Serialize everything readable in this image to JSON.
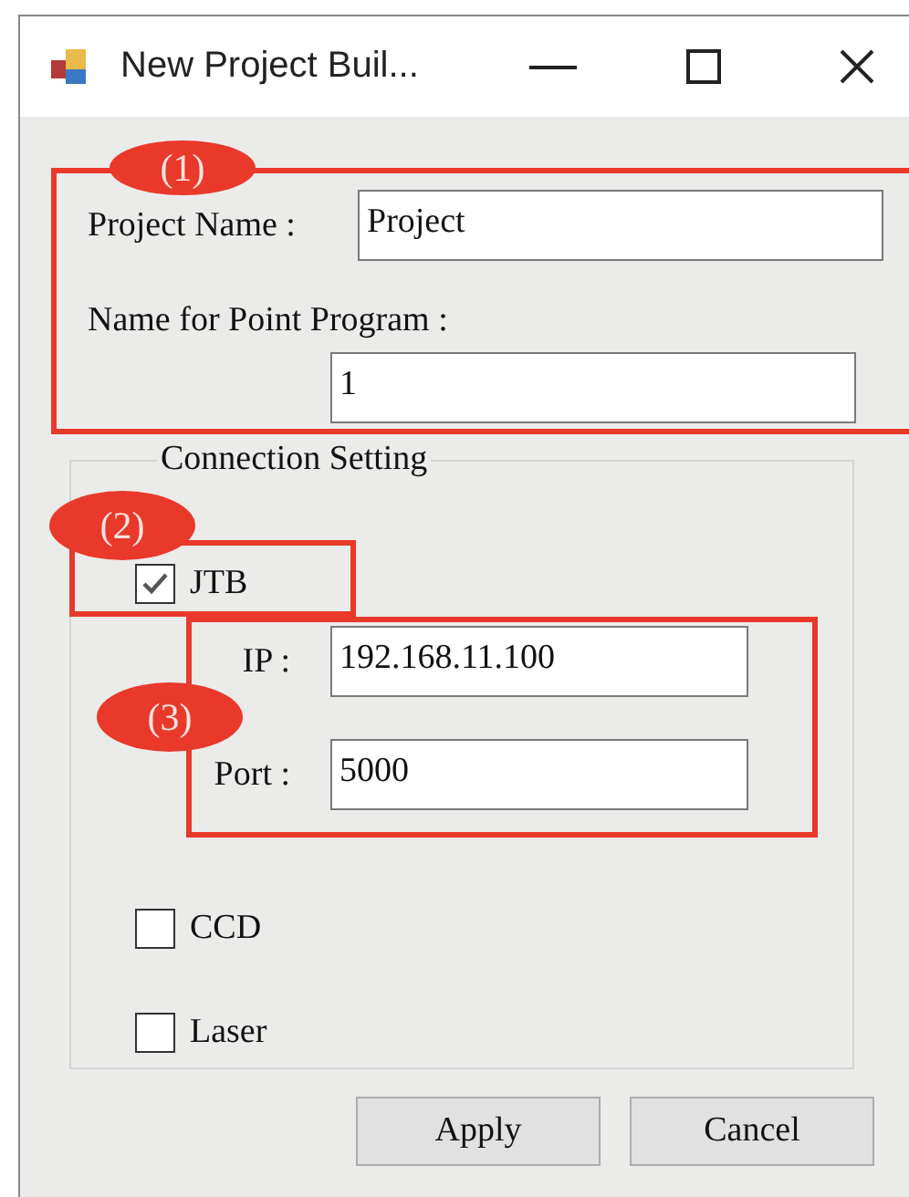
{
  "window": {
    "title": "New Project Buil..."
  },
  "project_name": {
    "label": "Project Name :",
    "value": "Project"
  },
  "point_program": {
    "label": "Name for Point Program :",
    "value": "1"
  },
  "connection_setting": {
    "title": "Connection Setting",
    "items": [
      {
        "kind": "checkbox",
        "label": "JTB",
        "checked": true
      },
      {
        "kind": "field",
        "label": "IP :",
        "value": "192.168.11.100"
      },
      {
        "kind": "field",
        "label": "Port :",
        "value": "5000"
      },
      {
        "kind": "checkbox",
        "label": "CCD",
        "checked": false
      },
      {
        "kind": "checkbox",
        "label": "Laser",
        "checked": false
      }
    ]
  },
  "buttons": [
    "Apply",
    "Cancel"
  ],
  "annotations": [
    {
      "label": "(1)"
    },
    {
      "label": "(2)"
    },
    {
      "label": "(3)"
    }
  ]
}
